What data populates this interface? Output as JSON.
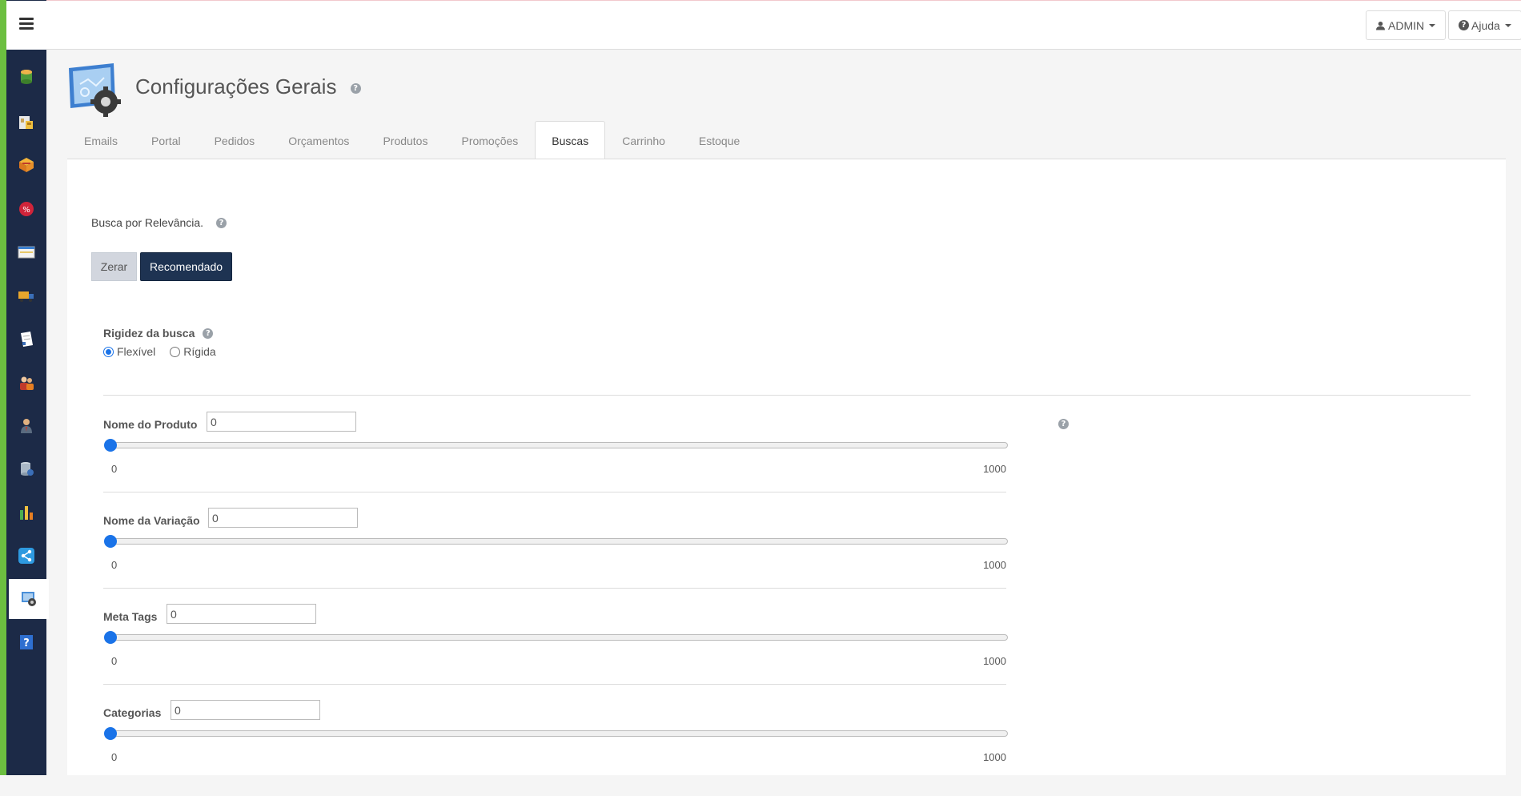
{
  "topbar": {
    "admin_label": "ADMIN",
    "help_label": "Ajuda"
  },
  "sidebar": {
    "items": [
      {
        "icon": "database-icon"
      },
      {
        "icon": "store-icon"
      },
      {
        "icon": "products-icon"
      },
      {
        "icon": "discount-icon"
      },
      {
        "icon": "window-icon"
      },
      {
        "icon": "truck-icon"
      },
      {
        "icon": "document-icon"
      },
      {
        "icon": "users-icon"
      },
      {
        "icon": "user-icon"
      },
      {
        "icon": "server-icon"
      },
      {
        "icon": "chart-icon"
      },
      {
        "icon": "share-icon"
      },
      {
        "icon": "settings-icon",
        "active": true
      },
      {
        "icon": "help-book-icon"
      }
    ]
  },
  "page": {
    "title": "Configurações Gerais"
  },
  "tabs": [
    {
      "label": "Emails"
    },
    {
      "label": "Portal"
    },
    {
      "label": "Pedidos"
    },
    {
      "label": "Orçamentos"
    },
    {
      "label": "Produtos"
    },
    {
      "label": "Promoções"
    },
    {
      "label": "Buscas",
      "active": true
    },
    {
      "label": "Carrinho"
    },
    {
      "label": "Estoque"
    }
  ],
  "search": {
    "relevance_label": "Busca por Relevância.",
    "reset_button": "Zerar",
    "recommended_button": "Recomendado",
    "rigidity_label": "Rigidez da busca",
    "rigidity_options": [
      "Flexível",
      "Rígida"
    ],
    "rigidity_selected": "Flexível",
    "fields": [
      {
        "label": "Nome do Produto",
        "value": "0",
        "min": "0",
        "max": "1000"
      },
      {
        "label": "Nome da Variação",
        "value": "0",
        "min": "0",
        "max": "1000"
      },
      {
        "label": "Meta Tags",
        "value": "0",
        "min": "0",
        "max": "1000"
      },
      {
        "label": "Categorias",
        "value": "0",
        "min": "0",
        "max": "1000"
      }
    ]
  },
  "colors": {
    "sidebar_bg": "#1c2a47",
    "accent_green": "#6cbf40",
    "primary_button": "#1e3352",
    "slider_thumb": "#1a73e8"
  }
}
